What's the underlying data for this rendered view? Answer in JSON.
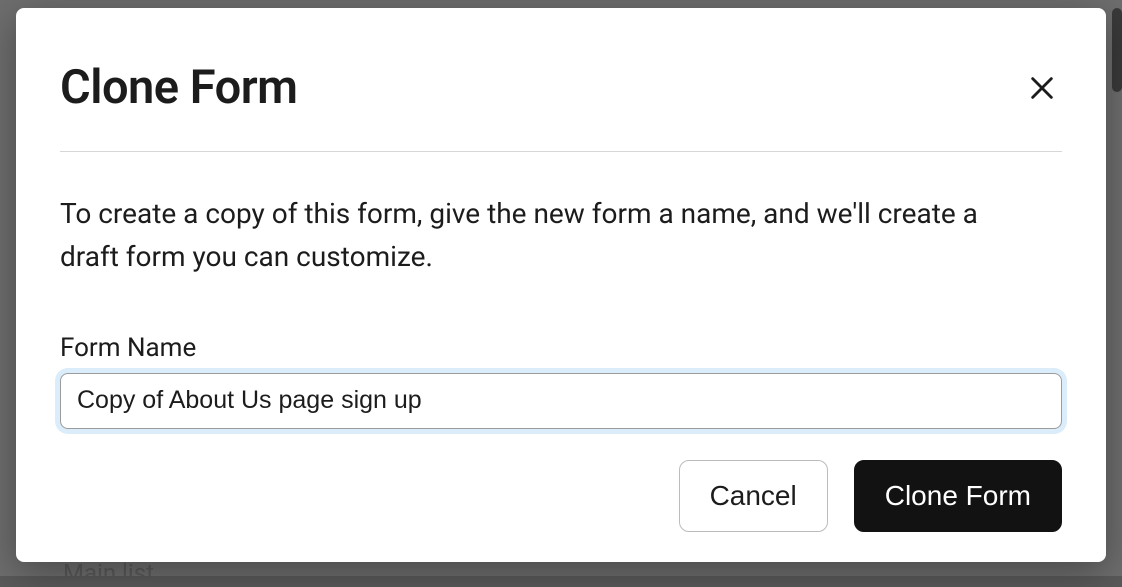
{
  "dialog": {
    "title": "Clone Form",
    "description": "To create a copy of this form, give the new form a name, and we'll create a draft form you can customize.",
    "field_label": "Form Name",
    "input_value": "Copy of About Us page sign up",
    "cancel_label": "Cancel",
    "submit_label": "Clone Form"
  },
  "background": {
    "main_list_label": "Main list"
  }
}
